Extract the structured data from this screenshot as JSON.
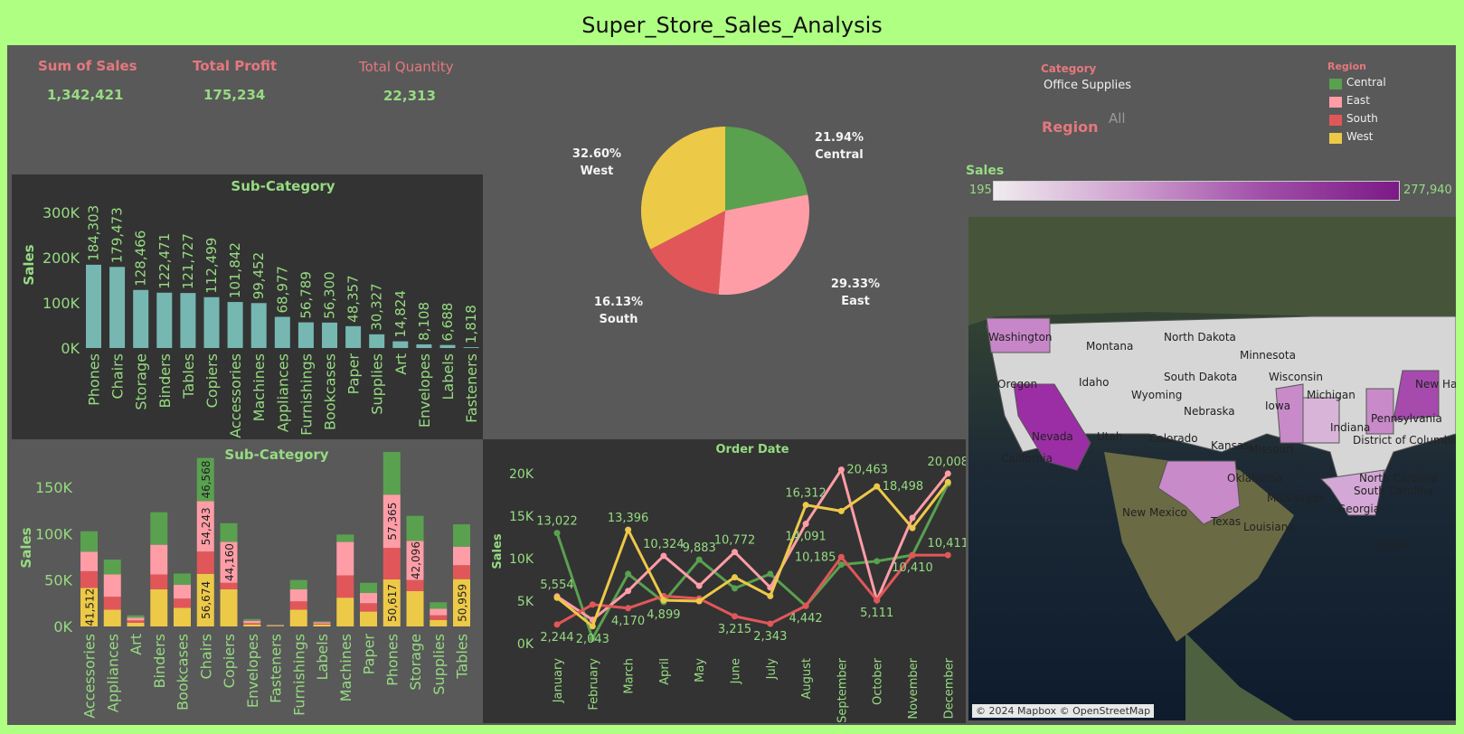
{
  "title": "Super_Store_Sales_Analysis",
  "kpis": [
    {
      "label": "Sum of Sales",
      "value": "1,342,421"
    },
    {
      "label": "Total Profit",
      "value": "175,234"
    },
    {
      "label": "Total Quantity",
      "value": "22,313"
    }
  ],
  "filters": {
    "category_label": "Category",
    "category_value": "Office Supplies",
    "region_label": "Region",
    "region_value": "All"
  },
  "region_legend": {
    "title": "Region",
    "items": [
      {
        "name": "Central",
        "color": "#59a14f"
      },
      {
        "name": "East",
        "color": "#ff9da7"
      },
      {
        "name": "South",
        "color": "#e15759"
      },
      {
        "name": "West",
        "color": "#edc948"
      }
    ]
  },
  "sales_scale": {
    "label": "Sales",
    "min": "195",
    "max": "277,940"
  },
  "map": {
    "attribution": "© 2024 Mapbox © OpenStreetMap",
    "states": [
      "Washington",
      "Montana",
      "North Dakota",
      "Minnesota",
      "Oregon",
      "Idaho",
      "South Dakota",
      "Wisconsin",
      "Wyoming",
      "Michigan",
      "New Ham",
      "Nebraska",
      "Iowa",
      "Pennsylvania",
      "Nevada",
      "Utah",
      "Colorado",
      "Indiana",
      "Kansas",
      "Missouri",
      "District of Columbia",
      "California",
      "Oklahoma",
      "North Carolina",
      "New Mexico",
      "South Carolina",
      "Mississippi",
      "Georgia",
      "Texas",
      "Louisiana",
      "Florida"
    ]
  },
  "chart_data": [
    {
      "type": "bar",
      "title": "Sub-Category",
      "ylabel": "Sales",
      "ylim": [
        0,
        300000
      ],
      "yticks": [
        "0K",
        "100K",
        "200K",
        "300K"
      ],
      "categories": [
        "Phones",
        "Chairs",
        "Storage",
        "Binders",
        "Tables",
        "Copiers",
        "Accessories",
        "Machines",
        "Appliances",
        "Furnishings",
        "Bookcases",
        "Paper",
        "Supplies",
        "Art",
        "Envelopes",
        "Labels",
        "Fasteners"
      ],
      "values": [
        184303,
        179473,
        128466,
        122471,
        121727,
        112499,
        101842,
        99452,
        68977,
        56789,
        56300,
        48357,
        30327,
        14824,
        8108,
        6688,
        1818
      ],
      "labels": [
        "184,303",
        "179,473",
        "128,466",
        "122,471",
        "121,727",
        "112,499",
        "101,842",
        "99,452",
        "68,977",
        "56,789",
        "56,300",
        "48,357",
        "30,327",
        "14,824",
        "8,108",
        "6,688",
        "1,818"
      ],
      "color": "#76b7b2"
    },
    {
      "type": "pie",
      "slices": [
        {
          "name": "Central",
          "value": 21.94,
          "label": "21.94%",
          "color": "#59a14f"
        },
        {
          "name": "East",
          "value": 29.33,
          "label": "29.33%",
          "color": "#ff9da7"
        },
        {
          "name": "South",
          "value": 16.13,
          "label": "16.13%",
          "color": "#e15759"
        },
        {
          "name": "West",
          "value": 32.6,
          "label": "32.60%",
          "color": "#edc948"
        }
      ]
    },
    {
      "type": "bar",
      "stacked": true,
      "title": "Sub-Category",
      "ylabel": "Sales",
      "ylim": [
        0,
        185000
      ],
      "yticks": [
        "0K",
        "50K",
        "100K",
        "150K"
      ],
      "categories": [
        "Accessories",
        "Appliances",
        "Art",
        "Binders",
        "Bookcases",
        "Chairs",
        "Copiers",
        "Envelopes",
        "Fasteners",
        "Furnishings",
        "Labels",
        "Machines",
        "Paper",
        "Phones",
        "Storage",
        "Supplies",
        "Tables"
      ],
      "series": [
        {
          "name": "West",
          "color": "#edc948",
          "values": [
            41512,
            18000,
            4000,
            40000,
            20000,
            56674,
            40000,
            2000,
            600,
            18000,
            2000,
            31000,
            16000,
            50617,
            38000,
            7000,
            50959
          ]
        },
        {
          "name": "South",
          "color": "#e15759",
          "values": [
            18000,
            14000,
            2500,
            16000,
            10000,
            24000,
            7000,
            1500,
            300,
            9000,
            1000,
            24000,
            9000,
            34000,
            12000,
            5000,
            15000
          ]
        },
        {
          "name": "East",
          "color": "#ff9da7",
          "values": [
            21000,
            24000,
            3000,
            32000,
            15000,
            54243,
            44160,
            2500,
            500,
            13000,
            1500,
            36000,
            11000,
            57365,
            42096,
            7000,
            20000
          ]
        },
        {
          "name": "Central",
          "color": "#59a14f",
          "values": [
            22000,
            16000,
            2500,
            35000,
            12000,
            46568,
            20000,
            2000,
            400,
            10000,
            1000,
            8000,
            11000,
            46000,
            27000,
            7000,
            24000
          ]
        }
      ],
      "segment_labels": [
        {
          "cat": 0,
          "series": 0,
          "text": "41,512"
        },
        {
          "cat": 5,
          "series": 0,
          "text": "56,674"
        },
        {
          "cat": 5,
          "series": 2,
          "text": "54,243"
        },
        {
          "cat": 5,
          "series": 3,
          "text": "46,568"
        },
        {
          "cat": 6,
          "series": 2,
          "text": "44,160"
        },
        {
          "cat": 13,
          "series": 0,
          "text": "50,617"
        },
        {
          "cat": 13,
          "series": 2,
          "text": "57,365"
        },
        {
          "cat": 14,
          "series": 2,
          "text": "42,096"
        },
        {
          "cat": 16,
          "series": 0,
          "text": "50,959"
        }
      ]
    },
    {
      "type": "line",
      "title": "Order Date",
      "ylabel": "Sales",
      "ylim": [
        0,
        20000
      ],
      "yticks": [
        "0K",
        "5K",
        "10K",
        "15K",
        "20K"
      ],
      "categories": [
        "January",
        "February",
        "March",
        "April",
        "May",
        "June",
        "July",
        "August",
        "September",
        "October",
        "November",
        "December"
      ],
      "series": [
        {
          "name": "Central",
          "color": "#59a14f",
          "values": [
            13022,
            600,
            8200,
            4899,
            9883,
            6500,
            8200,
            4442,
            9300,
            9700,
            10410,
            18800
          ]
        },
        {
          "name": "East",
          "color": "#ff9da7",
          "values": [
            5554,
            2800,
            6200,
            10324,
            6800,
            10772,
            6600,
            14091,
            20463,
            5111,
            14800,
            20008
          ]
        },
        {
          "name": "South",
          "color": "#e15759",
          "values": [
            2244,
            4600,
            4170,
            5600,
            5300,
            3215,
            2343,
            4442,
            10185,
            5111,
            10410,
            10411
          ]
        },
        {
          "name": "West",
          "color": "#edc948",
          "values": [
            5400,
            2043,
            13396,
            5100,
            5000,
            7800,
            5600,
            16312,
            15600,
            18498,
            13600,
            19000
          ]
        }
      ],
      "point_labels": [
        {
          "series": 0,
          "index": 0,
          "text": "13,022",
          "pos": "above"
        },
        {
          "series": 1,
          "index": 0,
          "text": "5,554",
          "pos": "above"
        },
        {
          "series": 2,
          "index": 0,
          "text": "2,244",
          "pos": "below"
        },
        {
          "series": 3,
          "index": 1,
          "text": "2,043",
          "pos": "below"
        },
        {
          "series": 3,
          "index": 2,
          "text": "13,396",
          "pos": "above"
        },
        {
          "series": 2,
          "index": 2,
          "text": "4,170",
          "pos": "below"
        },
        {
          "series": 1,
          "index": 3,
          "text": "10,324",
          "pos": "above"
        },
        {
          "series": 0,
          "index": 3,
          "text": "4,899",
          "pos": "below"
        },
        {
          "series": 0,
          "index": 4,
          "text": "9,883",
          "pos": "above"
        },
        {
          "series": 1,
          "index": 5,
          "text": "10,772",
          "pos": "above"
        },
        {
          "series": 2,
          "index": 5,
          "text": "3,215",
          "pos": "below"
        },
        {
          "series": 2,
          "index": 6,
          "text": "2,343",
          "pos": "below"
        },
        {
          "series": 3,
          "index": 7,
          "text": "16,312",
          "pos": "above"
        },
        {
          "series": 1,
          "index": 7,
          "text": "14,091",
          "pos": "below"
        },
        {
          "series": 0,
          "index": 7,
          "text": "4,442",
          "pos": "below"
        },
        {
          "series": 2,
          "index": 8,
          "text": "10,185",
          "pos": "left"
        },
        {
          "series": 1,
          "index": 8,
          "text": "20,463",
          "pos": "right"
        },
        {
          "series": 3,
          "index": 9,
          "text": "18,498",
          "pos": "right"
        },
        {
          "series": 1,
          "index": 9,
          "text": "5,111",
          "pos": "below"
        },
        {
          "series": 0,
          "index": 10,
          "text": "10,410",
          "pos": "below"
        },
        {
          "series": 1,
          "index": 11,
          "text": "20,008",
          "pos": "above"
        },
        {
          "series": 2,
          "index": 11,
          "text": "10,411",
          "pos": "above"
        }
      ]
    }
  ]
}
